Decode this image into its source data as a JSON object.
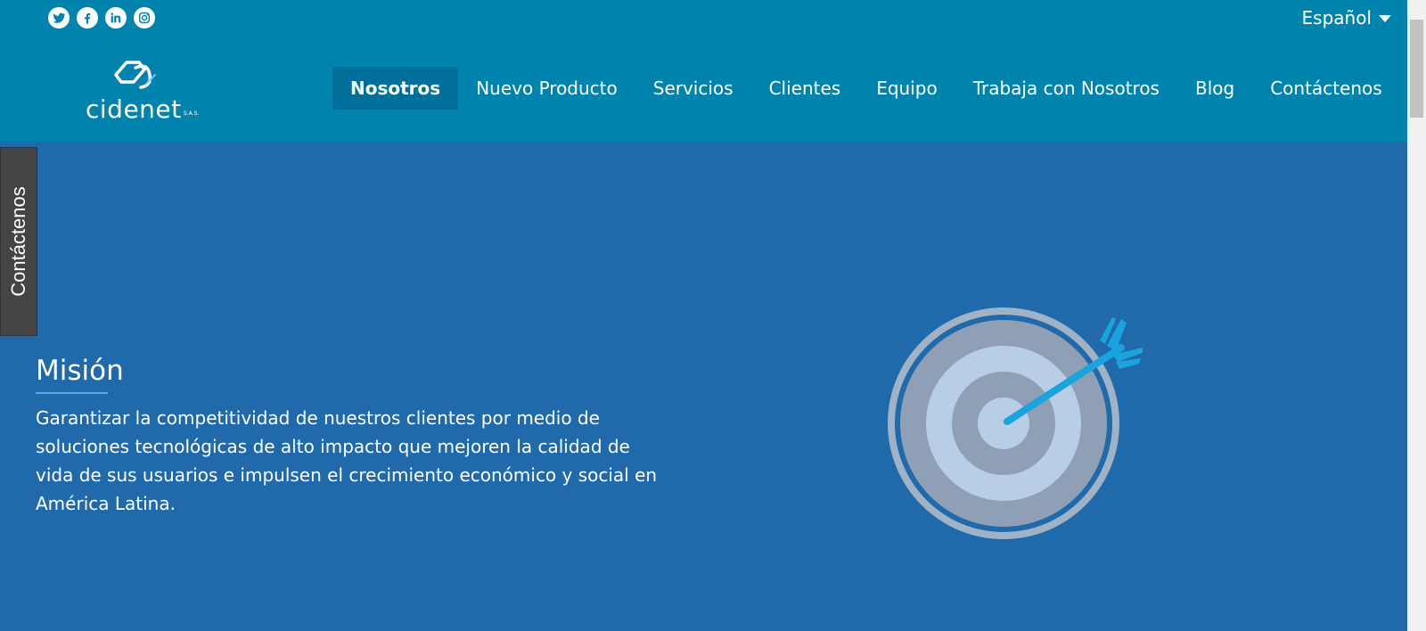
{
  "header": {
    "social": [
      {
        "icon": "twitter-icon"
      },
      {
        "icon": "facebook-icon"
      },
      {
        "icon": "linkedin-icon"
      },
      {
        "icon": "instagram-icon"
      }
    ],
    "language": "Español",
    "logo": {
      "text": "cidenet",
      "suffix": "S.A.S."
    },
    "nav": [
      {
        "label": "Nosotros",
        "active": true
      },
      {
        "label": "Nuevo Producto"
      },
      {
        "label": "Servicios"
      },
      {
        "label": "Clientes"
      },
      {
        "label": "Equipo"
      },
      {
        "label": "Trabaja con Nosotros"
      },
      {
        "label": "Blog"
      },
      {
        "label": "Contáctenos"
      }
    ]
  },
  "side_tab": {
    "label": "Contáctenos"
  },
  "mision": {
    "title": "Misión",
    "text": "Garantizar la competitividad de nuestros clientes por medio de soluciones tecnológicas de alto impacto que mejoren la calidad de vida de sus usuarios e impulsen el crecimiento económico y social en América Latina."
  },
  "colors": {
    "header_bg": "#0084ae",
    "nav_active_bg": "#00709a",
    "content_bg": "#2069ab",
    "side_tab_bg": "#444444",
    "arrow": "#1aa3dd"
  }
}
